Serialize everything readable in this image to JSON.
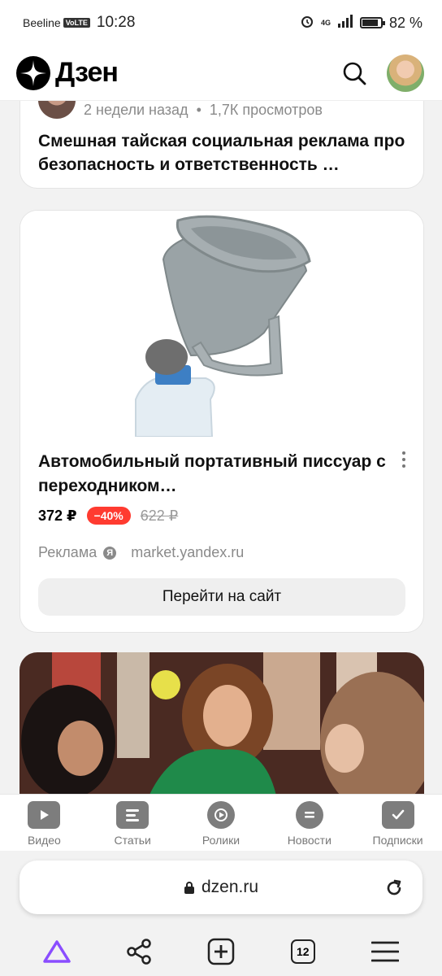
{
  "status_bar": {
    "carrier": "Beeline",
    "network_badge": "VoLTE",
    "time": "10:28",
    "signal": "4G",
    "battery": "82 %"
  },
  "header": {
    "brand": "Дзен",
    "icons": [
      "dzen-logo-icon",
      "search-icon",
      "avatar"
    ]
  },
  "feed": {
    "card1": {
      "age": "2 недели назад",
      "dot": "•",
      "views": "1,7К просмотров",
      "title": "Смешная тайская социальная реклама про безопасность и ответственность …"
    },
    "ad": {
      "title": "Автомобильный портативный писсуар с переходником…",
      "price": "372 ₽",
      "discount": "−40%",
      "old_price": "622 ₽",
      "label": "Реклама",
      "ya_badge": "Я",
      "domain": "market.yandex.ru",
      "cta": "Перейти на сайт"
    }
  },
  "bottom_tabs": [
    {
      "label": "Видео",
      "icon": "video-icon"
    },
    {
      "label": "Статьи",
      "icon": "articles-icon"
    },
    {
      "label": "Ролики",
      "icon": "clips-icon"
    },
    {
      "label": "Новости",
      "icon": "news-icon"
    },
    {
      "label": "Подписки",
      "icon": "subscriptions-icon"
    }
  ],
  "browser": {
    "url": "dzen.ru",
    "tabs_count": "12"
  },
  "colors": {
    "discount_bg": "#ff3b30",
    "alice_accent": "#8a4dff"
  }
}
